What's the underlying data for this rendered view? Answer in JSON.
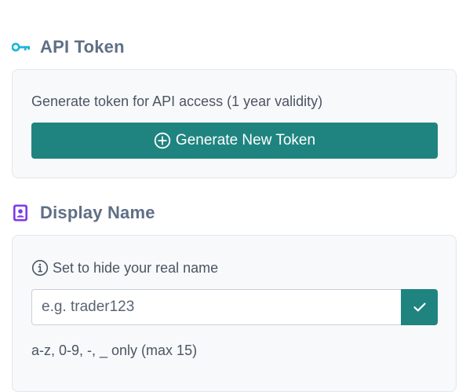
{
  "api_token": {
    "title": "API Token",
    "icon": "key-icon",
    "icon_color": "#19b6d6",
    "description": "Generate token for API access (1 year validity)",
    "generate_button_label": "Generate New Token",
    "generate_button_icon": "plus-circle-icon"
  },
  "display_name": {
    "title": "Display Name",
    "icon": "id-badge-icon",
    "icon_color": "#7c3aed",
    "hint": "Set to hide your real name",
    "hint_icon": "info-circle-icon",
    "input_value": "",
    "input_placeholder": "e.g. trader123",
    "confirm_button_icon": "check-icon",
    "rules": "a-z, 0-9, -, _ only (max 15)"
  },
  "colors": {
    "accent": "#1f8480",
    "card_background": "#f8f9fb",
    "card_border": "#e3e6eb",
    "heading": "#5f6f86"
  }
}
